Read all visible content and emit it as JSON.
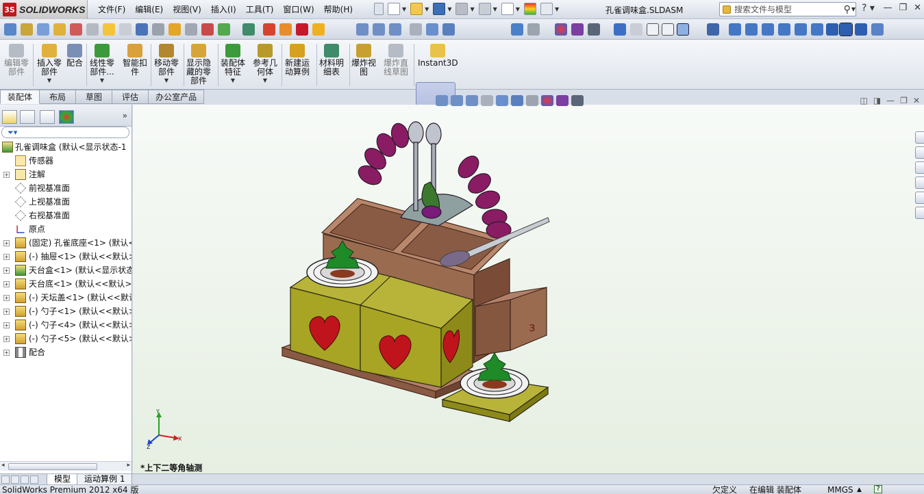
{
  "app": {
    "brand": "SOLIDWORKS",
    "document_title": "孔雀调味盒.SLDASM"
  },
  "menu": [
    "文件(F)",
    "编辑(E)",
    "视图(V)",
    "插入(I)",
    "工具(T)",
    "窗口(W)",
    "帮助(H)"
  ],
  "search": {
    "placeholder": "搜索文件与模型"
  },
  "command_manager": {
    "buttons": [
      {
        "label": "编辑零部件",
        "lines": [
          "编辑零",
          "部件"
        ],
        "dim": true
      },
      {
        "label": "插入零部件",
        "lines": [
          "插入零",
          "部件"
        ],
        "dim": false
      },
      {
        "label": "配合",
        "lines": [
          "配合"
        ],
        "dim": false
      },
      {
        "label": "线性零部件...",
        "lines": [
          "线性零",
          "部件..."
        ],
        "dim": false
      },
      {
        "label": "智能扣件",
        "lines": [
          "智能扣",
          "件"
        ],
        "dim": false
      },
      {
        "label": "移动零部件",
        "lines": [
          "移动零",
          "部件"
        ],
        "dim": false
      },
      {
        "label": "显示隐藏的零部件",
        "lines": [
          "显示隐",
          "藏的零",
          "部件"
        ],
        "dim": false
      },
      {
        "label": "装配体特征",
        "lines": [
          "装配体",
          "特征"
        ],
        "dim": false
      },
      {
        "label": "参考几何体",
        "lines": [
          "参考几",
          "何体"
        ],
        "dim": false
      },
      {
        "label": "新建运动算例",
        "lines": [
          "新建运",
          "动算例"
        ],
        "dim": false
      },
      {
        "label": "材料明细表",
        "lines": [
          "材料明",
          "细表"
        ],
        "dim": false
      },
      {
        "label": "爆炸视图",
        "lines": [
          "爆炸视",
          "图"
        ],
        "dim": false
      },
      {
        "label": "爆炸直线草图",
        "lines": [
          "爆炸直",
          "线草图"
        ],
        "dim": true
      },
      {
        "label": "Instant3D",
        "lines": [
          "Instant3D"
        ],
        "dim": false
      }
    ]
  },
  "tabs": [
    "装配体",
    "布局",
    "草图",
    "评估",
    "办公室产品"
  ],
  "tree": {
    "root": "孔雀调味盒 (默认<显示状态-1",
    "nodes": [
      {
        "text": "传感器",
        "expandable": false
      },
      {
        "text": "注解",
        "expandable": true
      },
      {
        "text": "前视基准面",
        "expandable": false
      },
      {
        "text": "上视基准面",
        "expandable": false
      },
      {
        "text": "右视基准面",
        "expandable": false
      },
      {
        "text": "原点",
        "expandable": false
      },
      {
        "text": "(固定) 孔雀底座<1> (默认<",
        "expandable": true
      },
      {
        "text": "(-) 抽屉<1> (默认<<默认>",
        "expandable": true
      },
      {
        "text": "天台盒<1> (默认<显示状态",
        "expandable": true
      },
      {
        "text": "天台底<1> (默认<<默认>_",
        "expandable": true
      },
      {
        "text": "(-) 天坛盖<1> (默认<<默认",
        "expandable": true
      },
      {
        "text": "(-) 勺子<1> (默认<<默认>",
        "expandable": true
      },
      {
        "text": "(-) 勺子<4> (默认<<默认>",
        "expandable": true
      },
      {
        "text": "(-) 勺子<5> (默认<<默认>",
        "expandable": true
      },
      {
        "text": "配合",
        "expandable": true
      }
    ]
  },
  "viewport": {
    "view_name": "*上下二等角轴测",
    "triad": {
      "x": "X",
      "y": "Y",
      "z": "Z"
    }
  },
  "sheet_tabs": [
    "模型",
    "运动算例 1"
  ],
  "status": {
    "product": "SolidWorks Premium 2012 x64 版",
    "defined": "欠定义",
    "mode": "在编辑 装配体",
    "units": "MMGS"
  },
  "colors": {
    "wood": "#9b6b50",
    "box_yellow": "#a8a424",
    "heart_red": "#c0141c",
    "peacock_purple": "#8a1c64"
  }
}
